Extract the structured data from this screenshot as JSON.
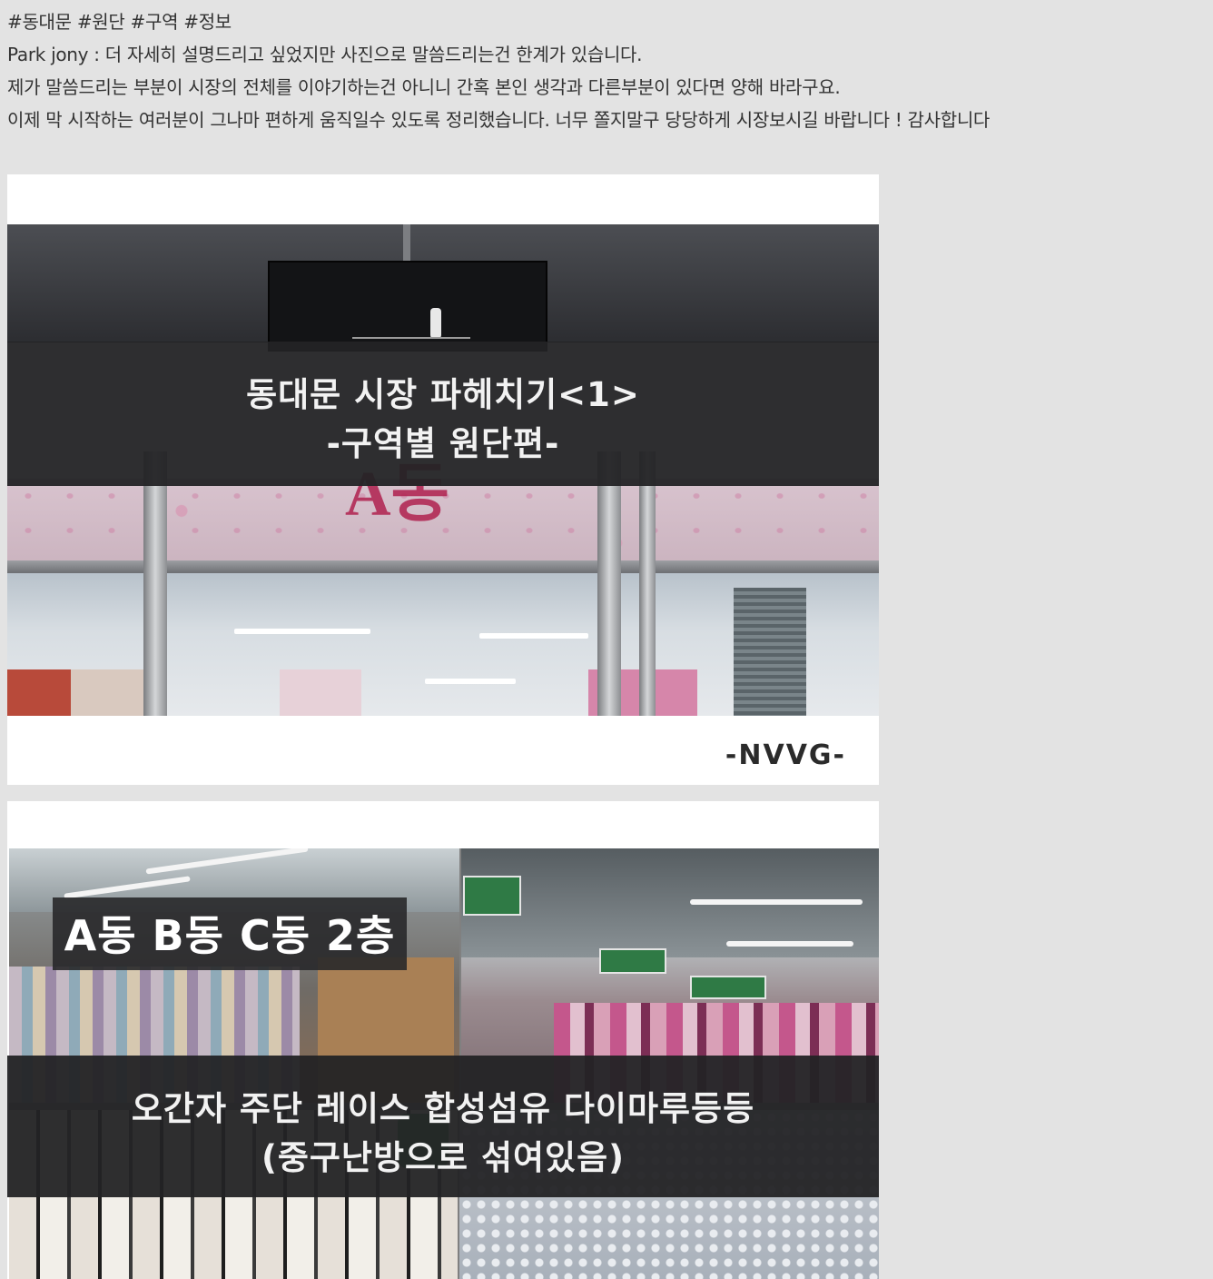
{
  "post": {
    "tags": "#동대문 #원단 #구역 #정보",
    "line1": "Park jony : 더 자세히 설명드리고 싶었지만 사진으로 말씀드리는건 한계가 있습니다.",
    "line2": "제가 말씀드리는 부분이 시장의 전체를 이야기하는건 아니니 간혹 본인 생각과 다른부분이 있다면 양해 바라구요.",
    "line3": "이제 막 시작하는 여러분이 그나마  편하게 움직일수 있도록 정리했습니다. 너무 쫄지말구 당당하게 시장보시길 바랍니다 ! 감사합니다"
  },
  "image1": {
    "title": "동대문 시장 파헤치기<1>",
    "subtitle": "-구역별 원단편-",
    "sign_text": "A동",
    "credit": "-NVVG-"
  },
  "image2": {
    "buildings": "A동 B동 C동 2층",
    "fabrics": "오간자 주단 레이스 합성섬유 다이마루등등",
    "note": "(중구난방으로 섞여있음)"
  }
}
